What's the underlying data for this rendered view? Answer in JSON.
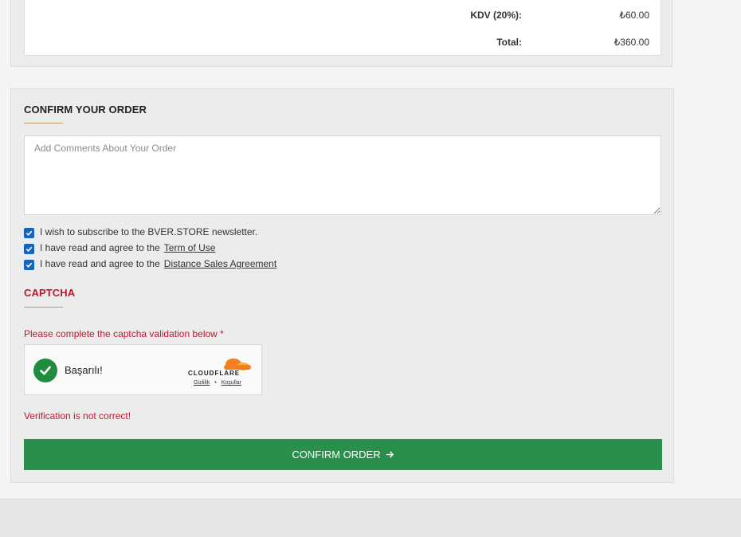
{
  "totals": {
    "tax_label": "KDV (20%):",
    "tax_value": "₺60.00",
    "total_label": "Total:",
    "total_value": "₺360.00"
  },
  "confirm": {
    "title": "CONFIRM YOUR ORDER",
    "comments_placeholder": "Add Comments About Your Order",
    "newsletter_label": "I wish to subscribe to the BVER.STORE newsletter.",
    "terms_prefix": "I have read and agree to the",
    "terms_link": "Term of Use",
    "sales_prefix": "I have read and agree to the",
    "sales_link": "Distance Sales Agreement"
  },
  "captcha": {
    "title": "CAPTCHA",
    "note": "Please complete the captcha validation below *",
    "status_text": "Başarılı!",
    "provider": "CLOUDFLARE",
    "privacy_link": "Gizlilik",
    "separator": "•",
    "terms_link": "Koşullar",
    "error": "Verification is not correct!"
  },
  "button": {
    "label": "CONFIRM ORDER"
  },
  "colors": {
    "accent_red": "#c0172d",
    "button_green": "#2b8f4c",
    "checkbox_blue": "#1565c0",
    "underline_gold": "#b59a6a"
  }
}
